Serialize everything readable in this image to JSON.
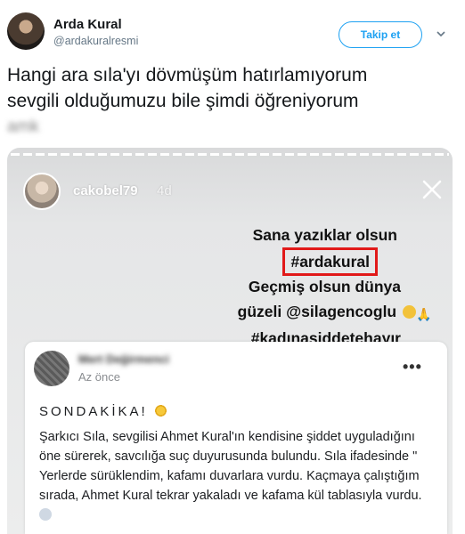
{
  "tweet": {
    "author_name": "Arda Kural",
    "author_handle": "@ardakuralresmi",
    "follow_label": "Takip et",
    "text_line1": "Hangi ara sıla'yı dövmüşüm hatırlamıyorum",
    "text_line2": "sevgili olduğumuzu bile şimdi öğreniyorum",
    "text_line3_blurred": "amk"
  },
  "story": {
    "username": "cakobel79",
    "time": "4d",
    "line1": "Sana yazıklar olsun",
    "line2": "#ardakural",
    "line3": "Geçmiş olsun dünya",
    "line4": "güzeli @silagencoglu",
    "line5": "#kadınaşiddetehayır",
    "highlight_color": "#e11919"
  },
  "fb_post": {
    "author_blurred": "Mert Değirmenci",
    "time": "Az önce",
    "heading": "SONDAKİKA!",
    "body": "Şarkıcı Sıla, sevgilisi Ahmet Kural'ın kendisine şiddet uyguladığını öne sürerek, savcılığa suç duyurusunda bulundu. Sıla ifadesinde \" Yerlerde sürüklendim, kafamı duvarlara vurdu. Kaçmaya çalıştığım sırada, Ahmet Kural tekrar yakaladı ve kafama kül tablasıyla vurdu."
  },
  "colors": {
    "accent": "#1da1f2",
    "text": "#14171a",
    "secondary": "#657786"
  }
}
